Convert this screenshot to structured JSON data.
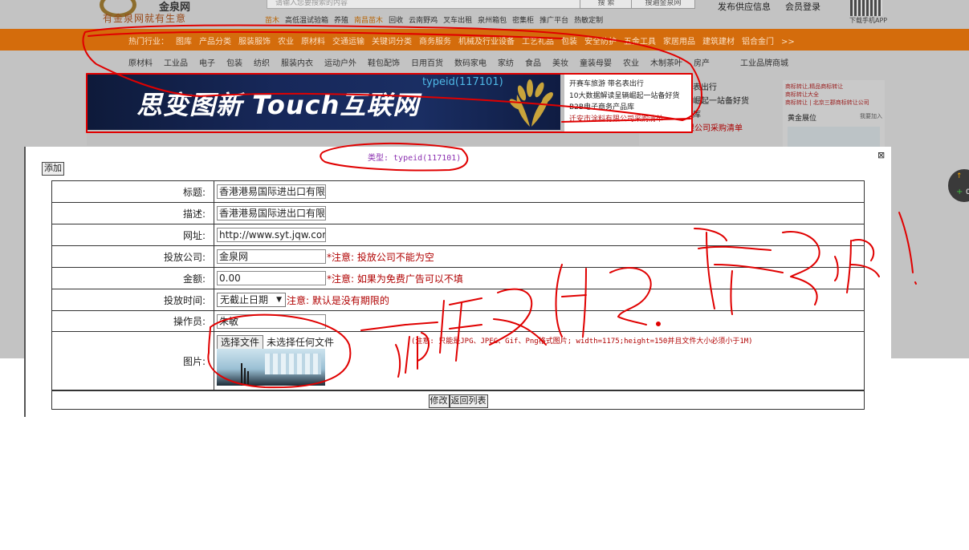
{
  "header": {
    "logo_text": "金泉网",
    "slogan": "有金泉网就有生意",
    "search_placeholder": "请输入您要搜索的内容",
    "search_button": "搜 索",
    "search_all_button": "搜遍金泉网",
    "publish_link": "发布供应信息",
    "login_link": "会员登录",
    "qr_label": "下载手机APP",
    "sublinks": [
      "苗木",
      "高低温试验箱",
      "养殖",
      "南昌苗木",
      "回收",
      "云南野鸡",
      "叉车出租",
      "泉州箱包",
      "密集柜",
      "推广平台",
      "热敏定制"
    ]
  },
  "nav": {
    "hot_label": "热门行业：",
    "hot_items": [
      "图库",
      "产品分类",
      "服装服饰",
      "农业",
      "原材料",
      "交通运输",
      "关键词分类",
      "商务服务",
      "机械及行业设备",
      "工艺礼品",
      "包装",
      "安全防护",
      "五金工具",
      "家居用品",
      "建筑建材",
      "铝合金门",
      ">>"
    ],
    "categories": [
      "原材料",
      "工业品",
      "电子",
      "包装",
      "纺织",
      "服装内衣",
      "运动户外",
      "鞋包配饰",
      "日用百货",
      "数码家电",
      "家纺",
      "食品",
      "美妆",
      "童装母婴",
      "农业",
      "木制茶叶",
      "房产",
      "工业品牌商城"
    ]
  },
  "banner": {
    "title": "思变图新 Touch互联网",
    "typeid": "typeid(117101)",
    "list": [
      "开赛车旅游 带名表出行",
      "10大数据解读呈辆崛起一站备好货",
      "B2B电子商务产品库",
      "迁安市涂料有限公司采购清单"
    ]
  },
  "side": {
    "mid_list": [
      "名表出行",
      "辆崛起一站备好货",
      "品库",
      "迁安市涂料有限公司采购清单"
    ],
    "right_list": [
      "商标转让,精品商标转让",
      "商标转让大全",
      "商标转让 | 北京三郡商标转让公司"
    ],
    "gold_title": "黄金展位",
    "gold_join": "我要加入"
  },
  "dialog": {
    "close_icon": "⊠",
    "type_label": "类型: typeid(117101)",
    "add_button": "添加",
    "fields": {
      "title_label": "标题:",
      "title_value": "香港港易国际进出口有限",
      "desc_label": "描述:",
      "desc_value": "香港港易国际进出口有限",
      "url_label": "网址:",
      "url_value": "http://www.syt.jqw.com/d",
      "company_label": "投放公司:",
      "company_value": "金泉网",
      "company_note": "*注意: 投放公司不能为空",
      "amount_label": "金额:",
      "amount_value": "0.00",
      "amount_note": "*注意: 如果为免费广告可以不填",
      "time_label": "投放时间:",
      "time_value": "无截止日期",
      "time_note": "注意: 默认是没有期限的",
      "operator_label": "操作员:",
      "operator_value": "朱敏",
      "image_label": "图片:",
      "file_button": "选择文件",
      "file_status": "未选择任何文件",
      "image_note": "(注意: 只能是JPG、JPEG、Gif、Png格式图片; width=1175;height=150并且文件大小必须小于1M)"
    },
    "modify_button": "修改",
    "back_button": "返回列表"
  },
  "float_widget": {
    "up": "↑",
    "plus": "+",
    "text": "0"
  },
  "colors": {
    "orange": "#d46c0c",
    "note_red": "#b00000",
    "annotation_red": "#e00000",
    "type_purple": "#8b2fb0"
  }
}
